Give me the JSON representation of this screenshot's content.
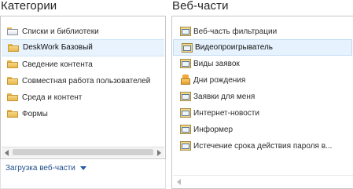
{
  "categories": {
    "title": "Категории",
    "items": [
      {
        "label": "Списки и библиотеки",
        "icon": "folder-open-icon"
      },
      {
        "label": "DeskWork Базовый",
        "icon": "folder-icon",
        "selected": true
      },
      {
        "label": "Сведение контента",
        "icon": "folder-icon"
      },
      {
        "label": "Совместная работа пользователей",
        "icon": "folder-icon"
      },
      {
        "label": "Среда и контент",
        "icon": "folder-icon"
      },
      {
        "label": "Формы",
        "icon": "folder-icon"
      }
    ],
    "upload_label": "Загрузка веб-части"
  },
  "webparts": {
    "title": "Веб-части",
    "items": [
      {
        "label": "Веб-часть фильтрации",
        "icon": "webpart-icon"
      },
      {
        "label": "Видеопроигрыватель",
        "icon": "webpart-icon",
        "selected": true
      },
      {
        "label": "Виды заявок",
        "icon": "webpart-icon"
      },
      {
        "label": "Дни рождения",
        "icon": "birthday-cake-icon"
      },
      {
        "label": "Заявки для меня",
        "icon": "webpart-icon"
      },
      {
        "label": "Интернет-новости",
        "icon": "webpart-icon"
      },
      {
        "label": "Информер",
        "icon": "webpart-icon"
      },
      {
        "label": "Истечение срока действия пароля в...",
        "icon": "webpart-icon"
      }
    ]
  },
  "colors": {
    "selection": "#e8f3fd",
    "link": "#1f4e8c",
    "folder": "#f0c969"
  }
}
